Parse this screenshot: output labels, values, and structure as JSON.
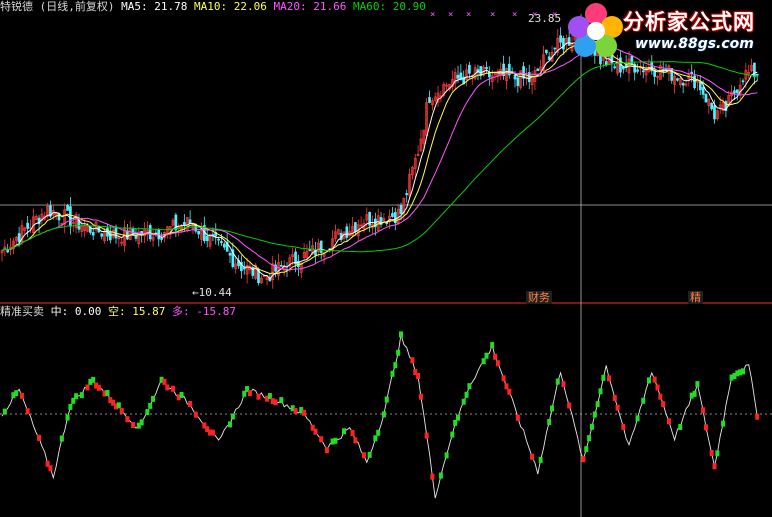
{
  "top_header": {
    "security": "特锐德 (日线,前复权)",
    "ma5_label": "MA5:",
    "ma5_value": "21.78",
    "ma10_label": "MA10:",
    "ma10_value": "22.06",
    "ma20_label": "MA20:",
    "ma20_value": "21.66",
    "ma60_label": "MA60:",
    "ma60_value": "20.90"
  },
  "bottom_header": {
    "indicator": "精准买卖",
    "mid_label": "中:",
    "mid_value": "0.00",
    "kong_label": "空:",
    "kong_value": "15.87",
    "duo_label": "多:",
    "duo_value": "-15.87"
  },
  "annotations": {
    "high_price": "23.85",
    "low_price": "10.44",
    "event_marker_1": "财务",
    "event_marker_2": "精"
  },
  "logo": {
    "title": "分析家公式网",
    "url": "www.88gs.com"
  },
  "colors": {
    "background": "#000000",
    "up_candle": "#ff3b3b",
    "down_candle": "#4ff0ff",
    "ma5": "#ffffff",
    "ma10": "#ffff55",
    "ma20": "#ff55ff",
    "ma60": "#00d000",
    "kong_line": "#e8e8e8",
    "duo_line": "#e8e8e8",
    "bull_marker": "#22dd22",
    "bear_marker": "#ff2222",
    "divider": "#cc2222",
    "crosshair": "#bbbbbb"
  },
  "chart_data": [
    {
      "type": "line",
      "title": "特锐德 (日线,前复权)",
      "note": "candlestick price chart with moving averages",
      "y_high_label": 23.85,
      "y_low_label": 10.44,
      "ylim": [
        9.5,
        24.5
      ],
      "close_keypoints": {
        "x": [
          0,
          10,
          16,
          30,
          40,
          56,
          66,
          84,
          92,
          100,
          110,
          120,
          126,
          135,
          140,
          146,
          150,
          158,
          166,
          176,
          186,
          192,
          204,
          210,
          216,
          222,
          230,
          238,
          244,
          250,
          254,
          260,
          265
        ],
        "y": [
          12.0,
          13.4,
          14.2,
          13.2,
          12.8,
          13.0,
          13.5,
          11.2,
          10.6,
          11.3,
          12.0,
          13.0,
          13.6,
          13.8,
          14.0,
          17.3,
          20.2,
          21.0,
          21.3,
          21.2,
          21.0,
          22.5,
          23.6,
          22.1,
          21.7,
          21.8,
          21.6,
          21.2,
          21.0,
          19.2,
          19.5,
          21.3,
          21.4
        ]
      },
      "series": [
        {
          "name": "MA5",
          "value": 21.78
        },
        {
          "name": "MA10",
          "value": 22.06
        },
        {
          "name": "MA20",
          "value": 21.66
        },
        {
          "name": "MA60",
          "value": 20.9
        }
      ]
    },
    {
      "type": "line",
      "title": "精准买卖",
      "ylim": [
        -20,
        20
      ],
      "series": [
        {
          "name": "中",
          "value": 0.0
        },
        {
          "name": "空",
          "value": 15.87
        },
        {
          "name": "多",
          "value": -15.87
        }
      ],
      "oscillator_keypoints": {
        "x": [
          0,
          6,
          12,
          18,
          24,
          32,
          40,
          48,
          56,
          66,
          76,
          86,
          96,
          106,
          114,
          122,
          128,
          134,
          140,
          146,
          152,
          158,
          164,
          172,
          180,
          188,
          196,
          204,
          212,
          220,
          228,
          236,
          244,
          250,
          256,
          262,
          265
        ],
        "y": [
          0,
          5,
          -4,
          -13,
          2,
          7,
          2,
          -3,
          7,
          2,
          -6,
          5,
          3,
          0,
          -7,
          -3,
          -10,
          0,
          16,
          8,
          -17,
          -4,
          6,
          14,
          1,
          -12,
          9,
          -10,
          10,
          -7,
          9,
          -5,
          6,
          -11,
          8,
          10,
          0
        ]
      }
    }
  ]
}
